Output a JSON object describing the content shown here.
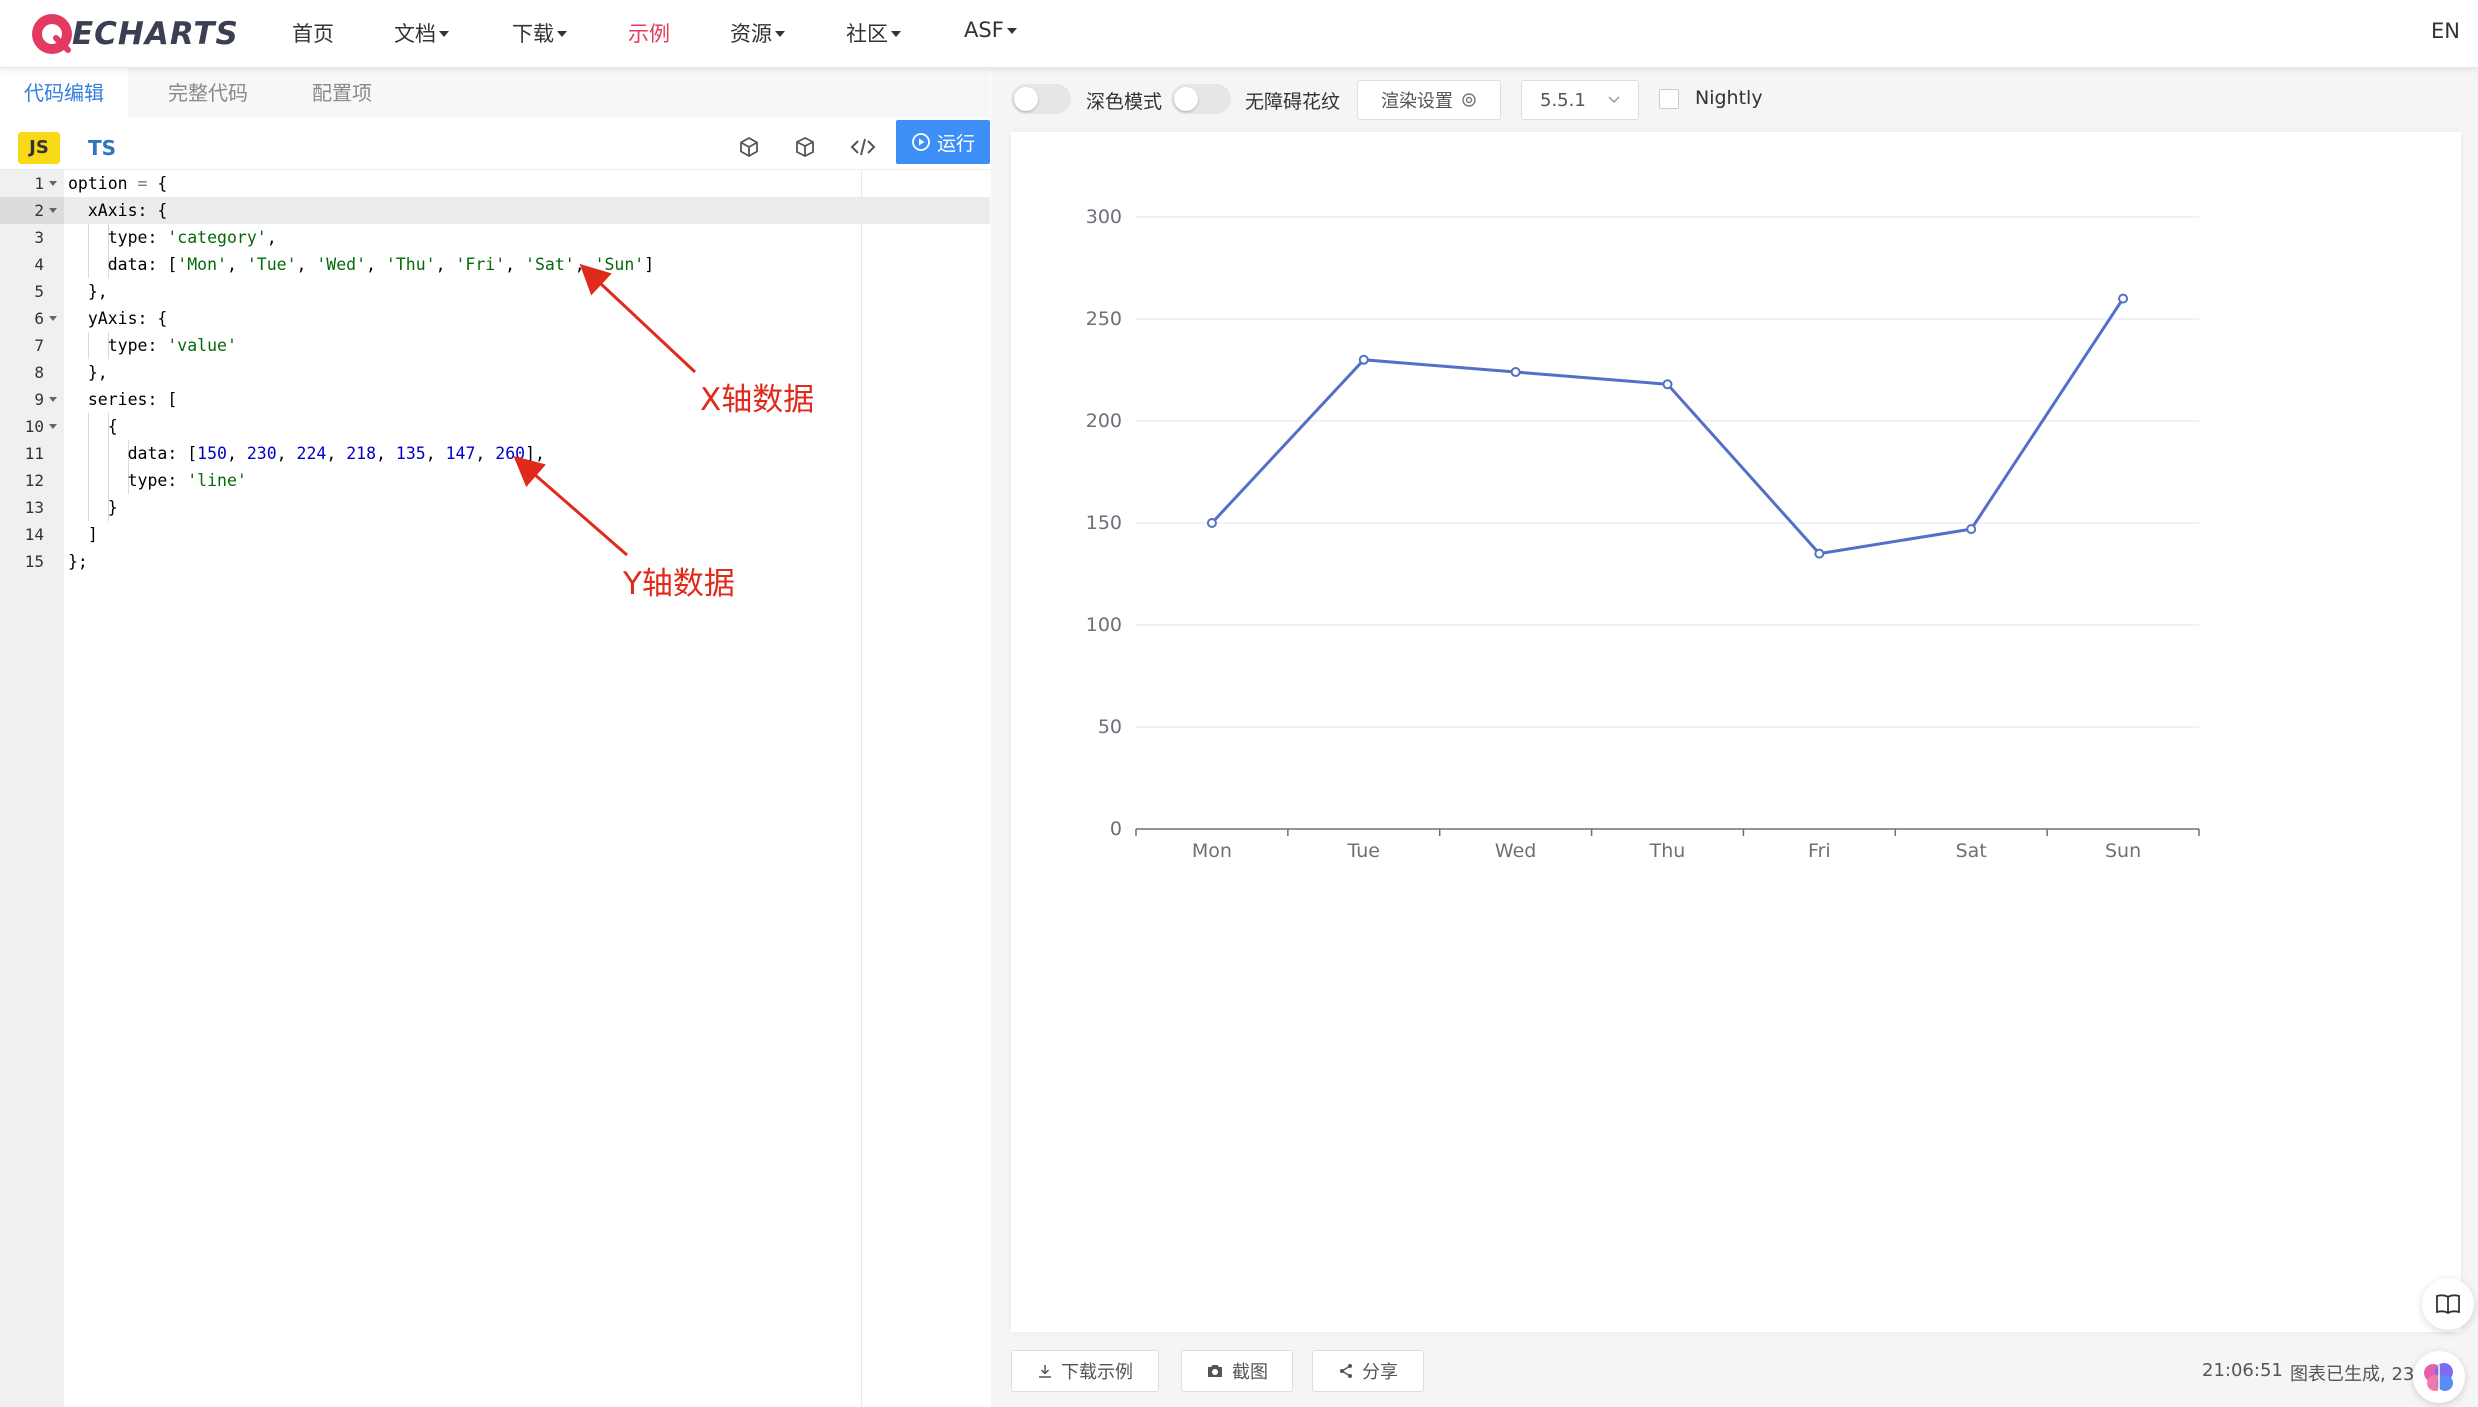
{
  "nav": {
    "logo_text": "ECHARTS",
    "items": [
      {
        "label": "首页",
        "dropdown": false,
        "active": false
      },
      {
        "label": "文档",
        "dropdown": true,
        "active": false
      },
      {
        "label": "下载",
        "dropdown": true,
        "active": false
      },
      {
        "label": "示例",
        "dropdown": false,
        "active": true
      },
      {
        "label": "资源",
        "dropdown": true,
        "active": false
      },
      {
        "label": "社区",
        "dropdown": true,
        "active": false
      },
      {
        "label": "ASF",
        "dropdown": true,
        "active": false
      }
    ],
    "lang": "EN",
    "accent_color": "#e43961"
  },
  "editor": {
    "tabs": [
      "代码编辑",
      "完整代码",
      "配置项"
    ],
    "active_tab": "代码编辑",
    "js_label": "JS",
    "ts_label": "TS",
    "run_label": "运行",
    "run_color": "#3e8ef7",
    "lines": [
      {
        "n": "1",
        "text": "option = {"
      },
      {
        "n": "2",
        "text": "  xAxis: {"
      },
      {
        "n": "3",
        "text": "    type: 'category',"
      },
      {
        "n": "4",
        "text": "    data: ['Mon', 'Tue', 'Wed', 'Thu', 'Fri', 'Sat', 'Sun']"
      },
      {
        "n": "5",
        "text": "  },"
      },
      {
        "n": "6",
        "text": "  yAxis: {"
      },
      {
        "n": "7",
        "text": "    type: 'value'"
      },
      {
        "n": "8",
        "text": "  },"
      },
      {
        "n": "9",
        "text": "  series: ["
      },
      {
        "n": "10",
        "text": "    {"
      },
      {
        "n": "11",
        "text": "      data: [150, 230, 224, 218, 135, 147, 260],"
      },
      {
        "n": "12",
        "text": "      type: 'line'"
      },
      {
        "n": "13",
        "text": "    }"
      },
      {
        "n": "14",
        "text": "  ]"
      },
      {
        "n": "15",
        "text": "};"
      }
    ],
    "annotations": {
      "x_data": "X轴数据",
      "y_data": "Y轴数据"
    }
  },
  "toolbar": {
    "dark_mode_label": "深色模式",
    "aria_label": "无障碍花纹",
    "render_settings_label": "渲染设置",
    "version": "5.5.1",
    "nightly_label": "Nightly"
  },
  "footer": {
    "download_label": "下载示例",
    "screenshot_label": "截图",
    "share_label": "分享",
    "time": "21:06:51",
    "status": "图表已生成, 23."
  },
  "chart_data": {
    "type": "line",
    "categories": [
      "Mon",
      "Tue",
      "Wed",
      "Thu",
      "Fri",
      "Sat",
      "Sun"
    ],
    "values": [
      150,
      230,
      224,
      218,
      135,
      147,
      260
    ],
    "ylim": [
      0,
      300
    ],
    "yticks": [
      "0",
      "50",
      "100",
      "150",
      "200",
      "250",
      "300"
    ],
    "color": "#5470c6",
    "grid": true
  }
}
